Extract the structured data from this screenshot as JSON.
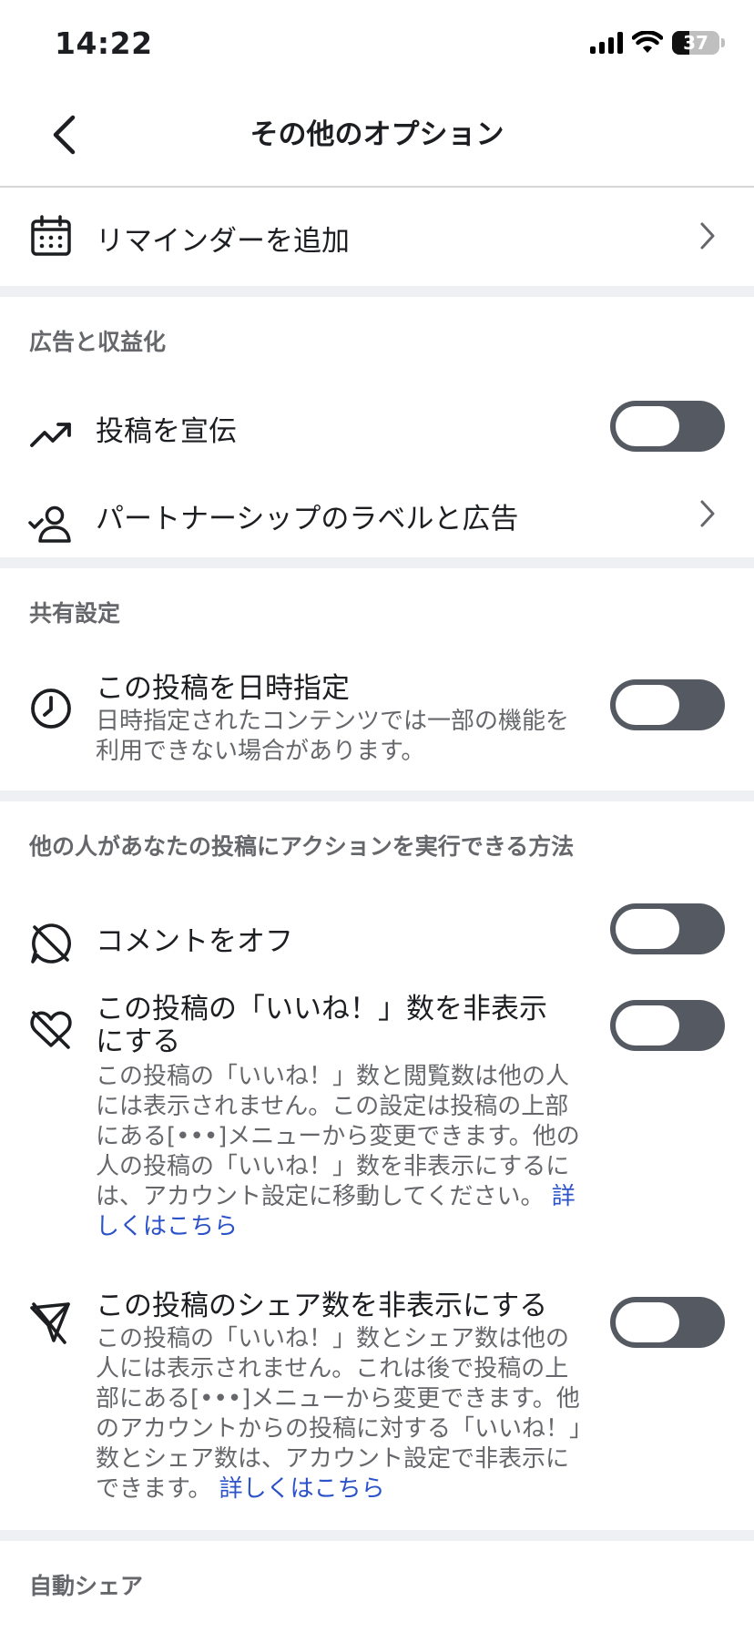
{
  "status": {
    "time": "14:22",
    "battery": "37",
    "battery_level": 0.37
  },
  "header": {
    "title": "その他のオプション"
  },
  "reminder": {
    "label": "リマインダーを追加"
  },
  "ads": {
    "section_title": "広告と収益化",
    "promote_label": "投稿を宣伝",
    "partnership_label": "パートナーシップのラベルと広告"
  },
  "sharing": {
    "section_title": "共有設定",
    "schedule_title": "この投稿を日時指定",
    "schedule_desc": "日時指定されたコンテンツでは一部の機能を利用できない場合があります。"
  },
  "actions": {
    "section_title": "他の人があなたの投稿にアクションを実行できる方法",
    "comments_label": "コメントをオフ",
    "hide_likes_title": "この投稿の「いいね！」数を非表示にする",
    "hide_likes_desc": "この投稿の「いいね！」数と閲覧数は他の人には表示されません。この設定は投稿の上部にある[•••]メニューから変更できます。他の人の投稿の「いいね！」数を非表示にするには、アカウント設定に移動してください。",
    "hide_likes_link": "詳しくはこちら",
    "hide_shares_title": "この投稿のシェア数を非表示にする",
    "hide_shares_desc": "この投稿の「いいね！」数とシェア数は他の人には表示されません。これは後で投稿の上部にある[•••]メニューから変更できます。他のアカウントからの投稿に対する「いいね！」数とシェア数は、アカウント設定で非表示にできます。",
    "hide_shares_link": "詳しくはこちら"
  },
  "auto_share": {
    "section_title": "自動シェア"
  },
  "colors": {
    "toggle_off": "#555a62",
    "link": "#2b52c8",
    "muted": "#65676b",
    "divider": "#eef0f3"
  }
}
